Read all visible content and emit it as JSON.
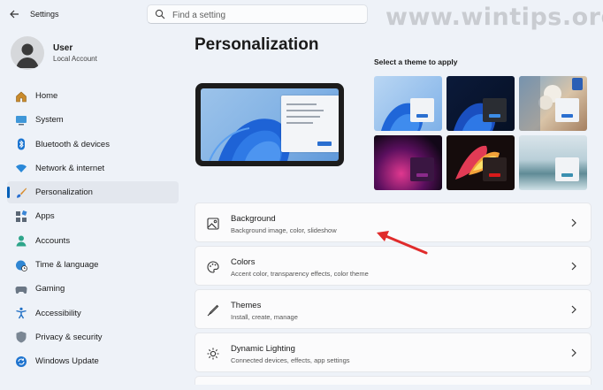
{
  "titlebar": {
    "back_icon": "back-arrow-icon",
    "title": "Settings"
  },
  "search": {
    "placeholder": "Find a setting",
    "icon": "search-icon"
  },
  "watermark": "www.wintips.org",
  "user": {
    "name": "User",
    "account_type": "Local Account"
  },
  "nav": {
    "items": [
      {
        "label": "Home",
        "icon": "home-icon",
        "active": false
      },
      {
        "label": "System",
        "icon": "system-icon",
        "active": false
      },
      {
        "label": "Bluetooth & devices",
        "icon": "bluetooth-icon",
        "active": false
      },
      {
        "label": "Network & internet",
        "icon": "wifi-icon",
        "active": false
      },
      {
        "label": "Personalization",
        "icon": "brush-icon",
        "active": true
      },
      {
        "label": "Apps",
        "icon": "apps-icon",
        "active": false
      },
      {
        "label": "Accounts",
        "icon": "accounts-icon",
        "active": false
      },
      {
        "label": "Time & language",
        "icon": "globe-clock-icon",
        "active": false
      },
      {
        "label": "Gaming",
        "icon": "gamepad-icon",
        "active": false
      },
      {
        "label": "Accessibility",
        "icon": "accessibility-icon",
        "active": false
      },
      {
        "label": "Privacy & security",
        "icon": "shield-icon",
        "active": false
      },
      {
        "label": "Windows Update",
        "icon": "windows-update-icon",
        "active": false
      }
    ]
  },
  "main": {
    "title": "Personalization",
    "themes_label": "Select a theme to apply",
    "themes": [
      {
        "name": "windows-light"
      },
      {
        "name": "windows-dark"
      },
      {
        "name": "spotlight"
      },
      {
        "name": "glow"
      },
      {
        "name": "captured-motion"
      },
      {
        "name": "flow"
      }
    ],
    "settings": [
      {
        "title": "Background",
        "subtitle": "Background image, color, slideshow",
        "icon": "image-icon"
      },
      {
        "title": "Colors",
        "subtitle": "Accent color, transparency effects, color theme",
        "icon": "palette-icon"
      },
      {
        "title": "Themes",
        "subtitle": "Install, create, manage",
        "icon": "pen-icon"
      },
      {
        "title": "Dynamic Lighting",
        "subtitle": "Connected devices, effects, app settings",
        "icon": "sun-icon"
      }
    ]
  },
  "colors": {
    "accent": "#005fb8",
    "annotation_arrow": "#e02b2b",
    "background": "#eef2f8"
  }
}
